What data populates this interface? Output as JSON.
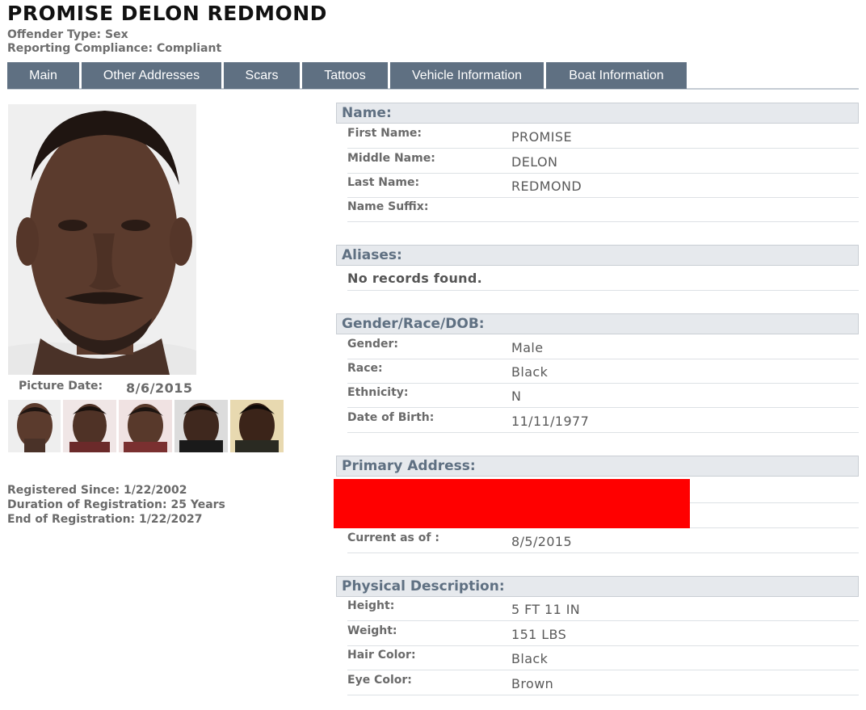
{
  "header": {
    "name": "PROMISE DELON REDMOND",
    "offender_type": "Offender Type: Sex",
    "compliance": "Reporting Compliance: Compliant"
  },
  "tabs": [
    {
      "label": "Main"
    },
    {
      "label": "Other Addresses"
    },
    {
      "label": "Scars"
    },
    {
      "label": "Tattoos"
    },
    {
      "label": "Vehicle Information"
    },
    {
      "label": "Boat Information"
    }
  ],
  "photo": {
    "picture_date_label": "Picture Date:",
    "picture_date": "8/6/2015"
  },
  "registration": {
    "since": "Registered Since: 1/22/2002",
    "duration": "Duration of Registration: 25 Years",
    "end": "End of Registration: 1/22/2027"
  },
  "sections": {
    "name": {
      "title": "Name:",
      "rows": [
        {
          "label": "First Name:",
          "value": "PROMISE"
        },
        {
          "label": "Middle Name:",
          "value": "DELON"
        },
        {
          "label": "Last Name:",
          "value": "REDMOND"
        },
        {
          "label": "Name Suffix:",
          "value": ""
        }
      ]
    },
    "aliases": {
      "title": "Aliases:",
      "message": "No records found."
    },
    "gender": {
      "title": "Gender/Race/DOB:",
      "rows": [
        {
          "label": "Gender:",
          "value": "Male"
        },
        {
          "label": "Race:",
          "value": "Black"
        },
        {
          "label": "Ethnicity:",
          "value": "N"
        },
        {
          "label": "Date of Birth:",
          "value": "11/11/1977"
        }
      ]
    },
    "address": {
      "title": "Primary Address:",
      "current_label": "Current as of :",
      "current_value": "8/5/2015"
    },
    "physical": {
      "title": "Physical Description:",
      "rows": [
        {
          "label": "Height:",
          "value": "5 FT 11 IN"
        },
        {
          "label": "Weight:",
          "value": "151 LBS"
        },
        {
          "label": "Hair Color:",
          "value": "Black"
        },
        {
          "label": "Eye Color:",
          "value": "Brown"
        }
      ]
    }
  },
  "colors": {
    "tab_bg": "#5f7082",
    "section_bg": "#e6e9ed",
    "section_text": "#5f7082",
    "redaction": "#ff0000"
  }
}
